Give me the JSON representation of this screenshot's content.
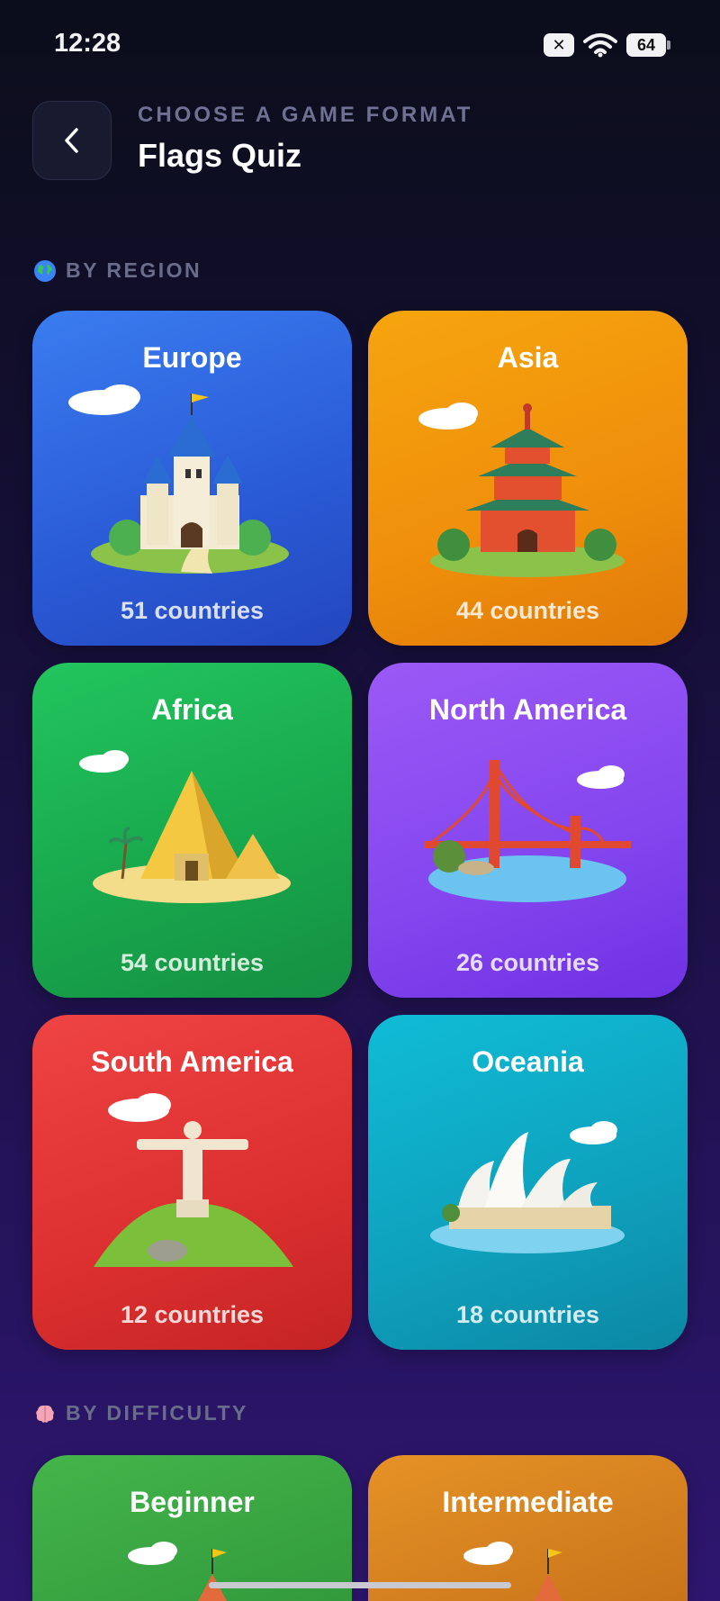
{
  "status_bar": {
    "time": "12:28",
    "battery": "64",
    "sim_label": "✕"
  },
  "header": {
    "eyebrow": "CHOOSE A GAME FORMAT",
    "title": "Flags Quiz"
  },
  "sections": {
    "region": {
      "label": "BY REGION",
      "icon": "globe-icon"
    },
    "difficulty": {
      "label": "BY DIFFICULTY",
      "icon": "brain-icon"
    }
  },
  "regions": [
    {
      "name": "Europe",
      "count": "51 countries",
      "color": "#2a5ad6",
      "icon": "castle-icon"
    },
    {
      "name": "Asia",
      "count": "44 countries",
      "color": "#ef8e0b",
      "icon": "pagoda-icon"
    },
    {
      "name": "Africa",
      "count": "54 countries",
      "color": "#18a64c",
      "icon": "pyramid-icon"
    },
    {
      "name": "North America",
      "count": "26 countries",
      "color": "#8345ee",
      "icon": "bridge-icon"
    },
    {
      "name": "South America",
      "count": "12 countries",
      "color": "#dc2f2f",
      "icon": "statue-icon"
    },
    {
      "name": "Oceania",
      "count": "18 countries",
      "color": "#0ea0bc",
      "icon": "opera-house-icon"
    }
  ],
  "difficulties": [
    {
      "name": "Beginner",
      "color": "#329a3c",
      "icon": "castle-icon"
    },
    {
      "name": "Intermediate",
      "color": "#c9741a",
      "icon": "castle-icon"
    }
  ]
}
